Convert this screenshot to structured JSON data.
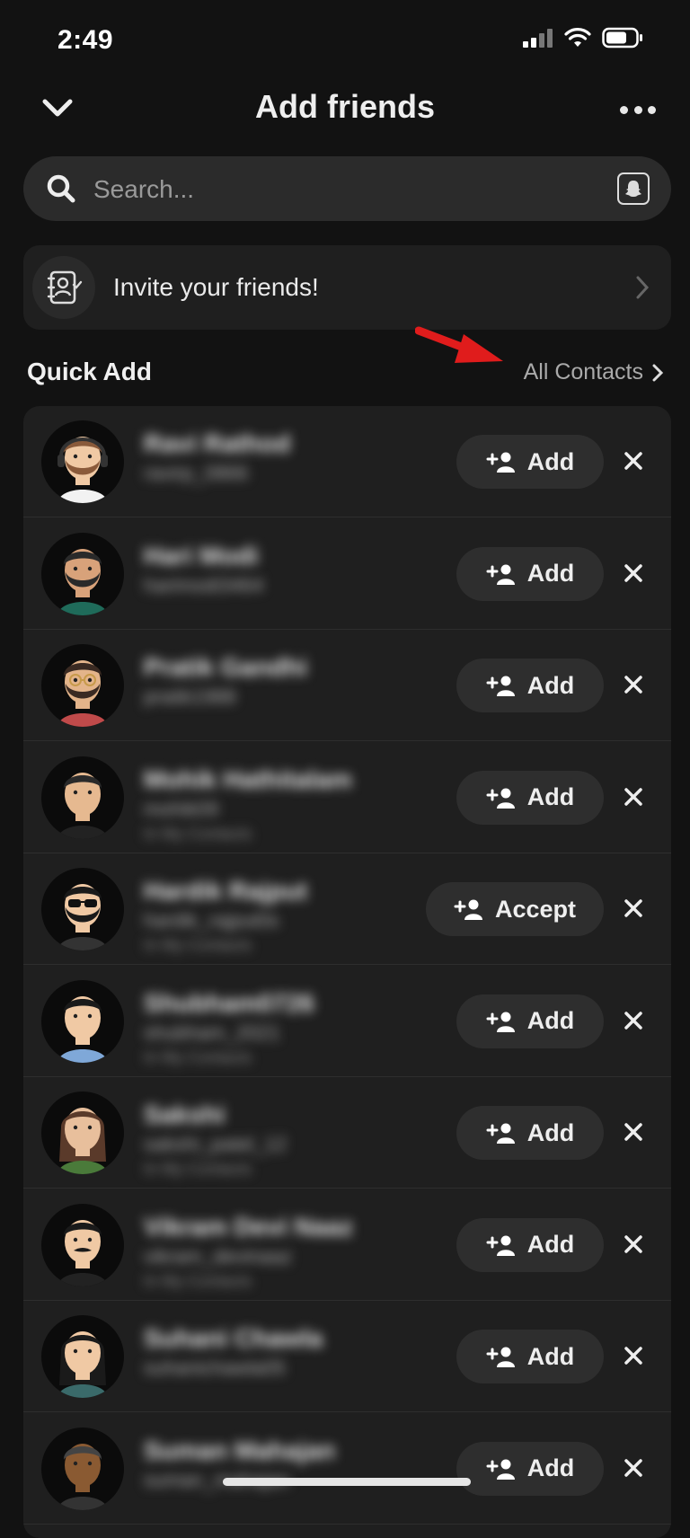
{
  "status_bar": {
    "time": "2:49"
  },
  "header": {
    "title": "Add friends"
  },
  "search": {
    "placeholder": "Search..."
  },
  "invite": {
    "label": "Invite your friends!"
  },
  "quick_add": {
    "title": "Quick Add",
    "all_contacts": "All Contacts",
    "rows": [
      {
        "name": "Ravi Rathod",
        "username": "ravirp_0866",
        "meta": "",
        "action": "Add",
        "avatar": "headset"
      },
      {
        "name": "Hari Modi",
        "username": "harimodi3464",
        "meta": "",
        "action": "Add",
        "avatar": "beard"
      },
      {
        "name": "Pratik Gandhi",
        "username": "pratik1988",
        "meta": "",
        "action": "Add",
        "avatar": "glasses"
      },
      {
        "name": "Mohik Hathitalam",
        "username": "mohik09",
        "meta": "In My Contacts",
        "action": "Add",
        "avatar": "plain"
      },
      {
        "name": "Hardik Rajput",
        "username": "hardik_rajput0s",
        "meta": "In My Contacts",
        "action": "Accept",
        "avatar": "sunglasses"
      },
      {
        "name": "Shubham0726",
        "username": "shubham_2021",
        "meta": "In My Contacts",
        "action": "Add",
        "avatar": "young"
      },
      {
        "name": "Sakshi",
        "username": "sakshi_patel_12",
        "meta": "In My Contacts",
        "action": "Add",
        "avatar": "female"
      },
      {
        "name": "Vikram Devi Naaz",
        "username": "vikram_devinaaz",
        "meta": "In My Contacts",
        "action": "Add",
        "avatar": "mustache"
      },
      {
        "name": "Suhani Chawla",
        "username": "suhanichawla05",
        "meta": "",
        "action": "Add",
        "avatar": "female2"
      },
      {
        "name": "Suman Mahajan",
        "username": "suman_mahajan",
        "meta": "",
        "action": "Add",
        "avatar": "dark"
      }
    ]
  },
  "colors": {
    "background": "#121212",
    "card": "#1f1f1f",
    "button": "#2e2e2e",
    "arrow": "#e01c1c"
  }
}
